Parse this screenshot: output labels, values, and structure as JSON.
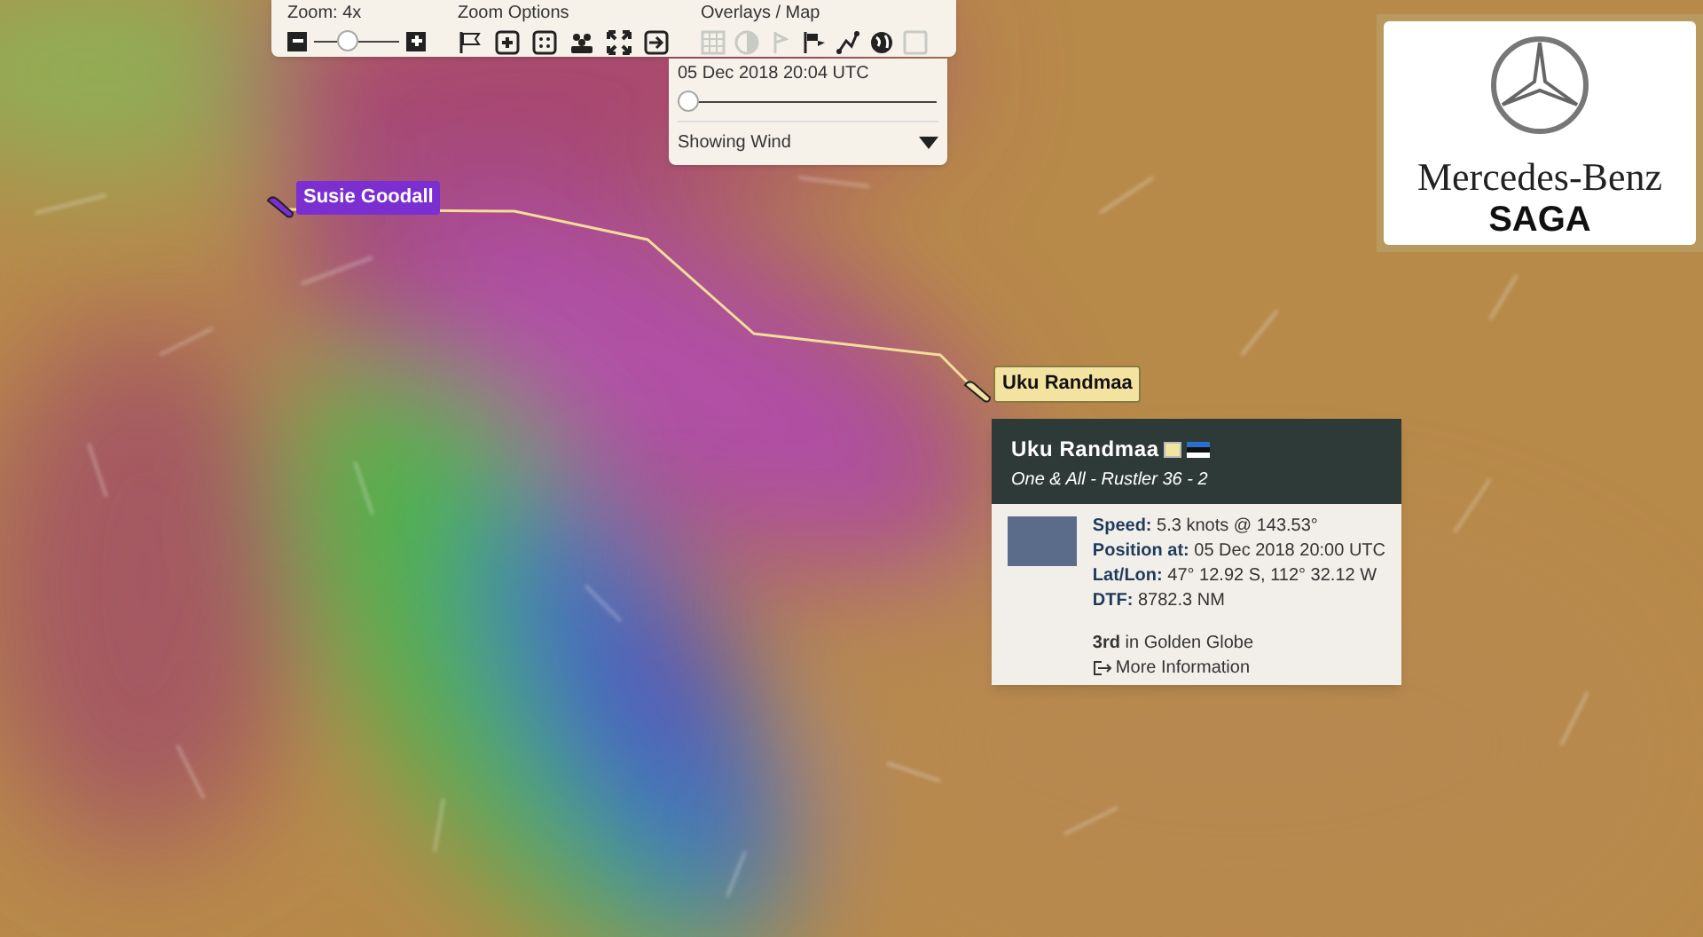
{
  "toolbar": {
    "zoom": {
      "label": "Zoom: 4x",
      "level": 0.35
    },
    "zoom_options": {
      "label": "Zoom Options",
      "buttons": [
        {
          "kind": "flag"
        },
        {
          "kind": "plus"
        },
        {
          "kind": "fit"
        },
        {
          "kind": "group"
        },
        {
          "kind": "expand"
        },
        {
          "kind": "exit"
        }
      ]
    },
    "overlays": {
      "label": "Overlays / Map",
      "items": [
        {
          "kind": "grid",
          "on": false
        },
        {
          "kind": "contrast",
          "on": false
        },
        {
          "kind": "mark",
          "on": false
        },
        {
          "kind": "flags",
          "on": true
        },
        {
          "kind": "route",
          "on": true
        },
        {
          "kind": "globe",
          "on": true
        },
        {
          "kind": "square",
          "on": false
        }
      ]
    }
  },
  "time_panel": {
    "timestamp": "05 Dec 2018 20:04 UTC",
    "level": 0,
    "layer": "Showing Wind"
  },
  "boats": [
    {
      "name": "Susie Goodall",
      "color": "#7b2fd0",
      "selected": false
    },
    {
      "name": "Uku Randmaa",
      "color": "#f3e3a0",
      "selected": true
    }
  ],
  "popup": {
    "name": "Uku Randmaa",
    "subtitle": "One & All - Rustler 36 - 2",
    "stats": [
      {
        "label": "Speed:",
        "value": "5.3 knots @ 143.53°"
      },
      {
        "label": "Position at:",
        "value": "05 Dec 2018 20:00 UTC"
      },
      {
        "label": "Lat/Lon:",
        "value": "47° 12.92 S, 112° 32.12 W"
      },
      {
        "label": "DTF:",
        "value": "8782.3 NM"
      }
    ],
    "rank": {
      "place": "3rd",
      "text": "in Golden Globe"
    },
    "link": "More Information"
  },
  "sponsor": {
    "brand": "Mercedes-Benz",
    "sub": "SAGA"
  }
}
